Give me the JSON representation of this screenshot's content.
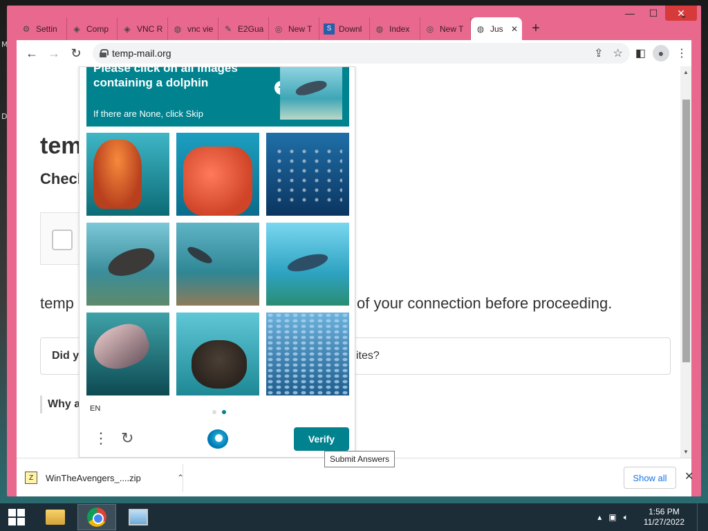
{
  "window": {
    "controls": {
      "minimize": "—",
      "maximize": "☐",
      "close": "✕"
    }
  },
  "tabs": [
    {
      "label": "Settin",
      "icon": "gear-icon"
    },
    {
      "label": "Comp",
      "icon": "cube-icon"
    },
    {
      "label": "VNC R",
      "icon": "cube-icon"
    },
    {
      "label": "vnc vie",
      "icon": "globe-icon"
    },
    {
      "label": "E2Gua",
      "icon": "leaf-icon"
    },
    {
      "label": "New T",
      "icon": "chrome-icon"
    },
    {
      "label": "Downl",
      "icon": "download-site-icon"
    },
    {
      "label": "Index",
      "icon": "globe-icon"
    },
    {
      "label": "New T",
      "icon": "chrome-icon"
    },
    {
      "label": "Jus",
      "icon": "globe-icon",
      "active": true
    }
  ],
  "toolbar": {
    "url": "temp-mail.org"
  },
  "page": {
    "title": "tem",
    "subtitle": "Checl",
    "body_left": "temp",
    "body_right": "of your connection before proceeding.",
    "faq1_left": "Did yo",
    "faq1_right": "ites?",
    "faq2": "Why a"
  },
  "captcha": {
    "prompt_line1": "Please click on all images",
    "prompt_line2": "containing a dolphin",
    "prompt_hint": "If there are None, click Skip",
    "images": [
      {
        "content": "jellyfish"
      },
      {
        "content": "coral"
      },
      {
        "content": "fish school"
      },
      {
        "content": "seal"
      },
      {
        "content": "dolphin"
      },
      {
        "content": "dolphin"
      },
      {
        "content": "dolphin"
      },
      {
        "content": "otter"
      },
      {
        "content": "fish school"
      }
    ],
    "language": "EN",
    "verify_label": "Verify",
    "tooltip": "Submit Answers",
    "page_dots": 2,
    "active_dot": 2,
    "accent_color": "#00838f"
  },
  "downloads": {
    "file_name": "WinTheAvengers_....zip",
    "show_all": "Show all"
  },
  "taskbar": {
    "time": "1:56 PM",
    "date": "11/27/2022"
  }
}
